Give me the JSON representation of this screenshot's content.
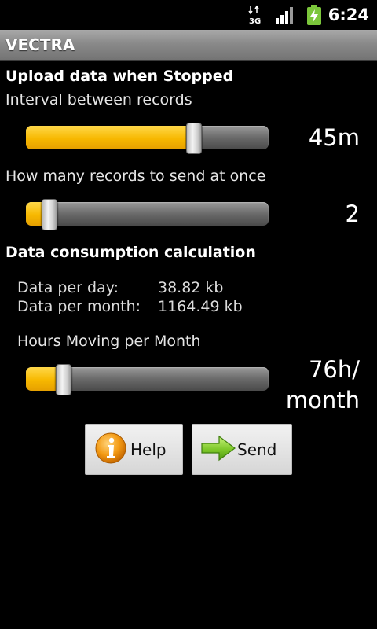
{
  "status_bar": {
    "network_icon": "3g-icon",
    "signal_icon": "signal-bars-icon",
    "battery_icon": "battery-charging-icon",
    "network_label": "3G",
    "time": "6:24"
  },
  "app": {
    "title": "VECTRA"
  },
  "upload_section": {
    "heading": "Upload data when Stopped",
    "interval": {
      "label": "Interval between records",
      "value_text": "45m",
      "level": 0.7
    },
    "records": {
      "label": "How many records to send at once",
      "value_text": "2",
      "level": 0.07
    }
  },
  "consumption_section": {
    "heading": "Data consumption calculation",
    "rows": [
      {
        "label": "Data per day:",
        "value": "38.82 kb"
      },
      {
        "label": "Data per month:",
        "value": "1164.49 kb"
      }
    ],
    "hours": {
      "label": "Hours Moving per Month",
      "value_line1": "76h/",
      "value_line2": "month",
      "level": 0.13
    }
  },
  "buttons": {
    "help_label": "Help",
    "help_icon": "info-icon",
    "send_label": "Send",
    "send_icon": "arrow-right-icon"
  },
  "colors": {
    "accent": "#f7b800",
    "title_bar": "#8a8a8a",
    "background": "#000000"
  }
}
